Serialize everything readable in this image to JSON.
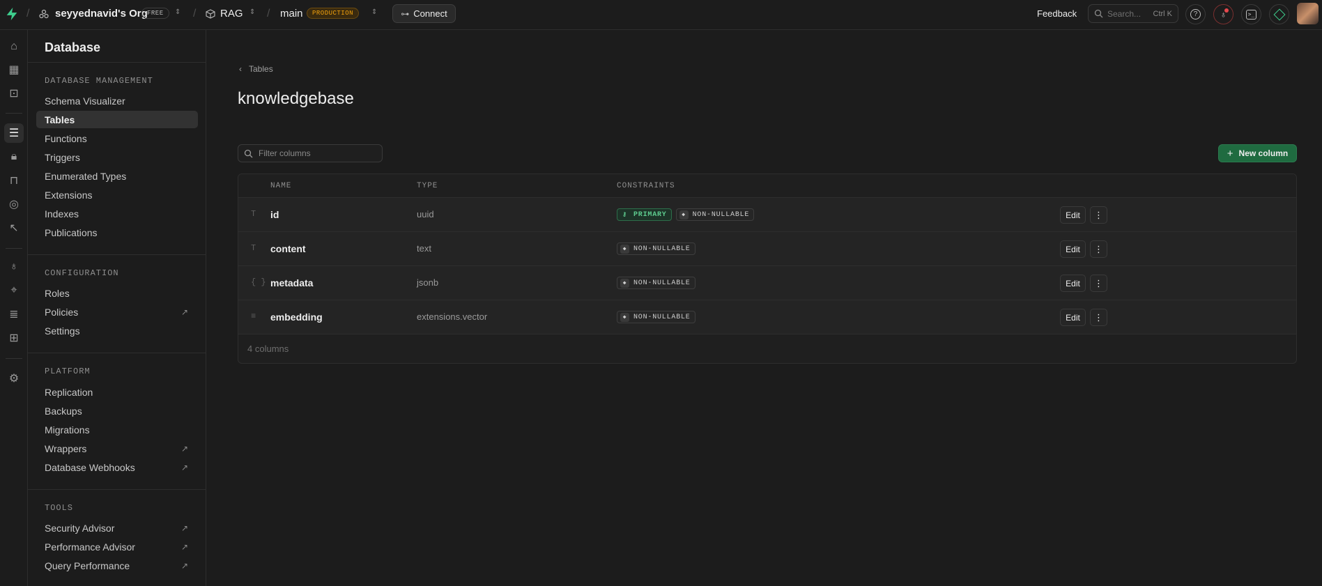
{
  "topbar": {
    "org_name": "seyyednavid's Org",
    "org_plan": "FREE",
    "project_name": "RAG",
    "branch_name": "main",
    "branch_env": "PRODUCTION",
    "connect_label": "Connect",
    "feedback_label": "Feedback",
    "search_placeholder": "Search...",
    "search_shortcut": "Ctrl K"
  },
  "sidebar": {
    "title": "Database",
    "sections": [
      {
        "title": "DATABASE MANAGEMENT",
        "items": [
          {
            "label": "Schema Visualizer"
          },
          {
            "label": "Tables",
            "active": true
          },
          {
            "label": "Functions"
          },
          {
            "label": "Triggers"
          },
          {
            "label": "Enumerated Types"
          },
          {
            "label": "Extensions"
          },
          {
            "label": "Indexes"
          },
          {
            "label": "Publications"
          }
        ]
      },
      {
        "title": "CONFIGURATION",
        "items": [
          {
            "label": "Roles"
          },
          {
            "label": "Policies",
            "external": true
          },
          {
            "label": "Settings"
          }
        ]
      },
      {
        "title": "PLATFORM",
        "items": [
          {
            "label": "Replication"
          },
          {
            "label": "Backups"
          },
          {
            "label": "Migrations"
          },
          {
            "label": "Wrappers",
            "external": true
          },
          {
            "label": "Database Webhooks",
            "external": true
          }
        ]
      },
      {
        "title": "TOOLS",
        "items": [
          {
            "label": "Security Advisor",
            "external": true
          },
          {
            "label": "Performance Advisor",
            "external": true
          },
          {
            "label": "Query Performance",
            "external": true
          }
        ]
      }
    ]
  },
  "main": {
    "back_label": "Tables",
    "title": "knowledgebase",
    "filter_placeholder": "Filter columns",
    "new_column_label": "New column",
    "table": {
      "headers": {
        "name": "NAME",
        "type": "TYPE",
        "constraints": "CONSTRAINTS"
      },
      "rows": [
        {
          "icon": "T",
          "name": "id",
          "type": "uuid",
          "primary": "PRIMARY",
          "nullable": "NON-NULLABLE"
        },
        {
          "icon": "T",
          "name": "content",
          "type": "text",
          "nullable": "NON-NULLABLE"
        },
        {
          "icon": "{ }",
          "name": "metadata",
          "type": "jsonb",
          "nullable": "NON-NULLABLE"
        },
        {
          "icon": "≡",
          "name": "embedding",
          "type": "extensions.vector",
          "nullable": "NON-NULLABLE"
        }
      ],
      "edit_label": "Edit",
      "footer": "4 columns"
    }
  },
  "colors": {
    "accent_green": "#3ecf8e",
    "production_badge": "#f1a10d",
    "background": "#1c1c1c"
  }
}
